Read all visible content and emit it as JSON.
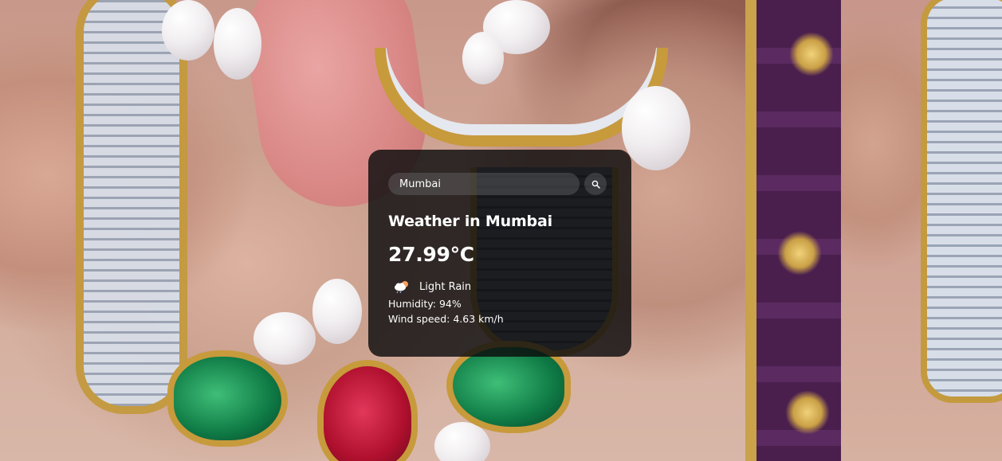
{
  "search": {
    "value": "Mumbai",
    "button_icon": "search-icon"
  },
  "weather": {
    "title": "Weather in Mumbai",
    "temperature": "27.99°C",
    "condition_icon": "cloud-rain-icon",
    "description": "Light Rain",
    "humidity": "Humidity: 94%",
    "wind": "Wind speed: 4.63 km/h"
  },
  "colors": {
    "card_background": "#0c0c0e",
    "text": "#ffffff",
    "icon_cloud": "#ffffff",
    "icon_sun": "#f5a25d"
  }
}
